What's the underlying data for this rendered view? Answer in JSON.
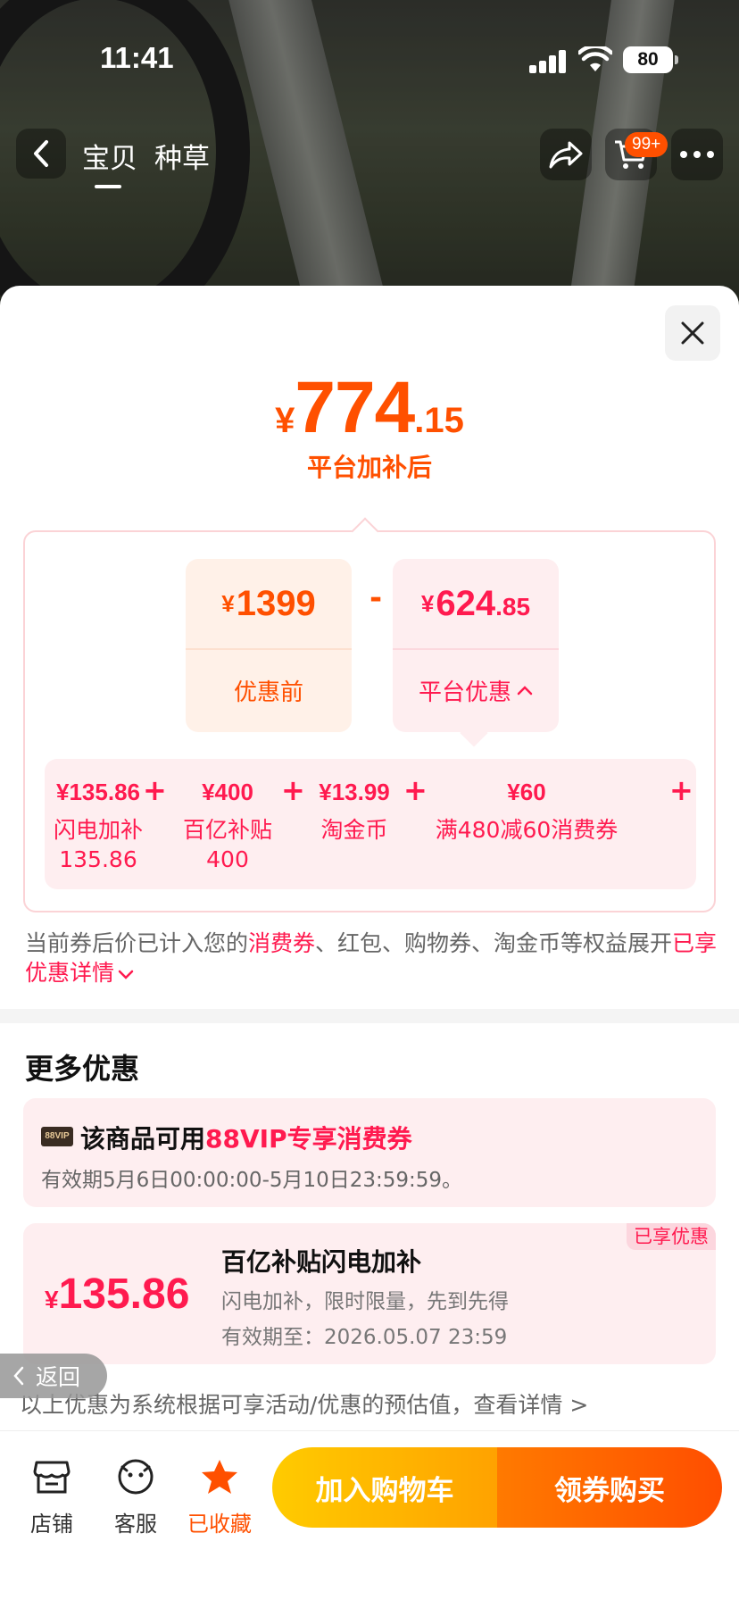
{
  "status_bar": {
    "time": "11:41",
    "battery": "80"
  },
  "nav": {
    "tab_item": "宝贝",
    "tab_grass": "种草",
    "cart_badge": "99+"
  },
  "summary": {
    "final_price": {
      "currency": "¥",
      "integer": "774",
      "decimal": ".15"
    },
    "caption": "平台加补后"
  },
  "breakdown": {
    "before": {
      "currency": "¥",
      "amount": "1399",
      "label": "优惠前"
    },
    "operator": "-",
    "platform": {
      "currency": "¥",
      "integer": "624",
      "decimal": ".85",
      "label": "平台优惠",
      "chevron": "^"
    },
    "items": [
      {
        "value": "¥135.86",
        "name_line1": "闪电加补",
        "name_line2": "135.86"
      },
      {
        "value": "¥400",
        "name_line1": "百亿补贴",
        "name_line2": "400"
      },
      {
        "value": "¥13.99",
        "name_line1": "淘金币",
        "name_line2": ""
      },
      {
        "value": "¥60",
        "name_line1": "满480减60消费券",
        "name_line2": ""
      }
    ],
    "plus": "+"
  },
  "note": {
    "part1": "当前券后价已计入您的",
    "highlight1": "消费券",
    "part2": "、红包、购物券、淘金币等权益展开",
    "link": "已享优惠详情"
  },
  "more": {
    "title": "更多优惠",
    "vip_card": {
      "badge": "88VIP",
      "title_prefix": "该商品可用",
      "title_highlight": "88VIP专享消费券",
      "validity": "有效期5月6日00:00:00-5月10日23:59:59。"
    },
    "flash_card": {
      "tag": "已享优惠",
      "currency": "¥",
      "amount": "135.86",
      "title": "百亿补贴闪电加补",
      "desc": "闪电加补，限时限量，先到先得",
      "validity": "有效期至：2026.05.07 23:59"
    },
    "disclaimer": "以上优惠为系统根据可享活动/优惠的预估值，查看详情 >"
  },
  "float_back": {
    "label": "返回"
  },
  "bottom_bar": {
    "store": "店铺",
    "service": "客服",
    "favorited": "已收藏",
    "add_to_cart": "加入购物车",
    "buy": "领券购买"
  },
  "colors": {
    "accent_orange": "#ff5000",
    "accent_red": "#ff1a4f",
    "pink_bg": "#feeef0"
  }
}
